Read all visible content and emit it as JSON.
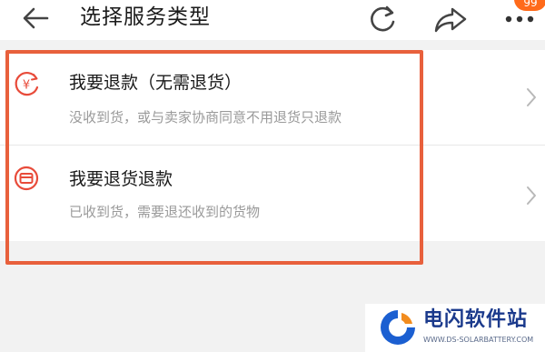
{
  "header": {
    "title": "选择服务类型",
    "badge": "99",
    "icons": [
      "back-arrow-icon",
      "refresh-icon",
      "share-icon",
      "more-icon"
    ]
  },
  "items": [
    {
      "title": "我要退款（无需退货）",
      "description": "没收到货，或与卖家协商同意不用退货只退款",
      "icon": "yen-refund-icon"
    },
    {
      "title": "我要退货退款",
      "description": "已收到货，需要退还收到的货物",
      "icon": "return-goods-icon"
    }
  ],
  "watermark": {
    "name": "电闪软件站",
    "url": "WWW.DS-SOLARBATTERY.COM"
  },
  "colors": {
    "accent": "#e8603c",
    "badge": "#ff6a1a",
    "icon_red": "#e84b3a",
    "watermark_blue": "#1b3a8c"
  }
}
